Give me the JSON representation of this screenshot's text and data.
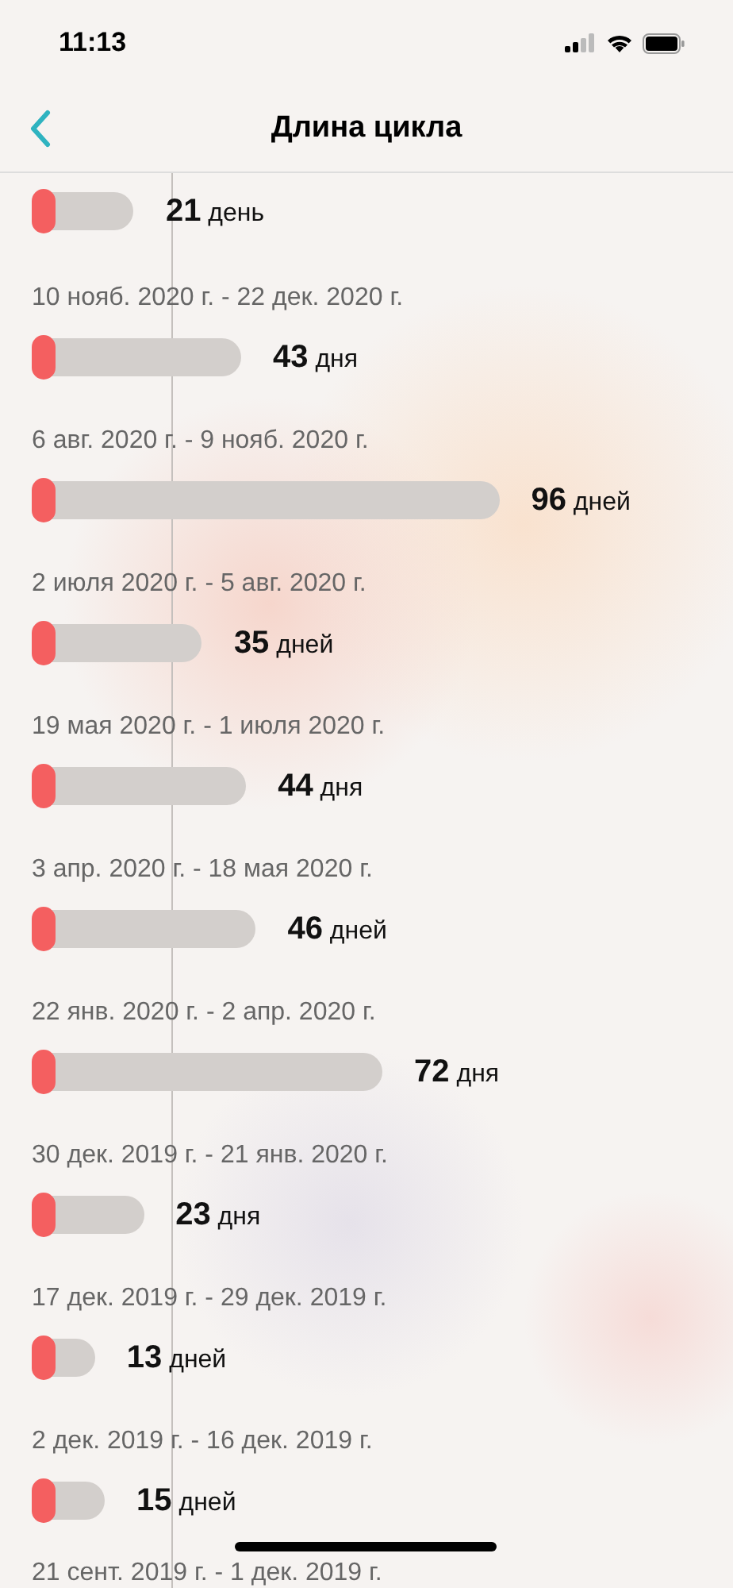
{
  "status_bar": {
    "time": "11:13"
  },
  "nav": {
    "title": "Длина цикла"
  },
  "cycles": [
    {
      "value": "21",
      "unit": "день"
    },
    {
      "dates": "10 нояб. 2020 г. - 22 дек. 2020 г.",
      "value": "43",
      "unit": "дня"
    },
    {
      "dates": "6 авг. 2020 г. - 9 нояб. 2020 г.",
      "value": "96",
      "unit": "дней"
    },
    {
      "dates": "2 июля 2020 г. - 5 авг. 2020 г.",
      "value": "35",
      "unit": "дней"
    },
    {
      "dates": "19 мая 2020 г. - 1 июля 2020 г.",
      "value": "44",
      "unit": "дня"
    },
    {
      "dates": "3 апр. 2020 г. - 18 мая 2020 г.",
      "value": "46",
      "unit": "дней"
    },
    {
      "dates": "22 янв. 2020 г. - 2 апр. 2020 г.",
      "value": "72",
      "unit": "дня"
    },
    {
      "dates": "30 дек. 2019 г. - 21 янв. 2020 г.",
      "value": "23",
      "unit": "дня"
    },
    {
      "dates": "17 дек. 2019 г. - 29 дек. 2019 г.",
      "value": "13",
      "unit": "дней"
    },
    {
      "dates": "2 дек. 2019 г. - 16 дек. 2019 г.",
      "value": "15",
      "unit": "дней"
    },
    {
      "dates": "21 сент. 2019 г. - 1 дек. 2019 г."
    }
  ]
}
